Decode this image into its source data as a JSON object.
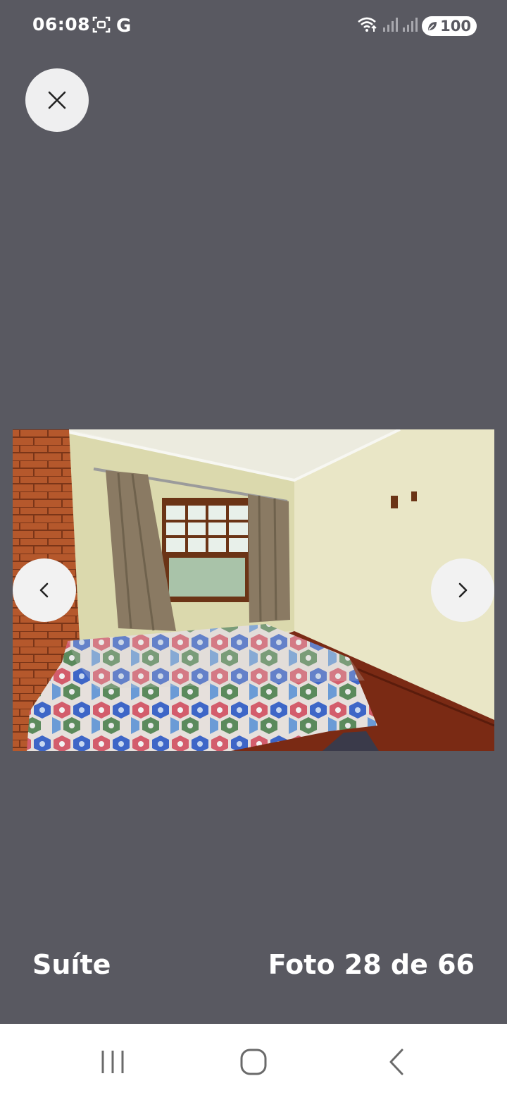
{
  "status_bar": {
    "time": "06:08",
    "left_icons": [
      "screenshot-icon",
      "google-icon"
    ],
    "google_letter": "G",
    "right_icons": [
      "wifi-icon",
      "signal-icon",
      "signal-icon",
      "battery-icon"
    ],
    "battery": "100"
  },
  "viewer": {
    "close_icon": "close-icon",
    "prev_icon": "chevron-left-icon",
    "next_icon": "chevron-right-icon",
    "photo_subject": "bedroom-photo",
    "caption": "Suíte",
    "counter": "Foto 28 de 66"
  },
  "system_nav": {
    "buttons": [
      "recents-icon",
      "home-icon",
      "back-icon"
    ]
  },
  "colors": {
    "background": "#595961",
    "button_bg": "#efeff0",
    "text": "#ffffff",
    "nav_bar": "#ffffff"
  }
}
